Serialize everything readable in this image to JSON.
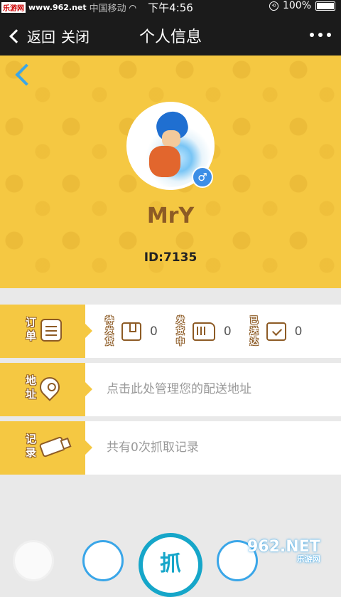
{
  "status_bar": {
    "watermark": "乐游网",
    "url": "www.962.net",
    "carrier": "中国移动",
    "time": "下午4:56",
    "battery": "100%"
  },
  "nav": {
    "back_label": "返回",
    "close_label": "关闭",
    "title": "个人信息"
  },
  "profile": {
    "username": "MrY",
    "id_text": "ID:7135",
    "gender_symbol": "♂"
  },
  "orders": {
    "tag_label": "订单",
    "items": [
      {
        "label": "待发货",
        "count": "0",
        "icon": "box-icon"
      },
      {
        "label": "发货中",
        "count": "0",
        "icon": "truck-icon"
      },
      {
        "label": "已送达",
        "count": "0",
        "icon": "delivered-icon"
      }
    ]
  },
  "address": {
    "tag_label": "地址",
    "text": "点击此处管理您的配送地址"
  },
  "records": {
    "tag_label": "记录",
    "text": "共有0次抓取记录"
  },
  "bottom": {
    "grab_label": "抓",
    "watermark": "962.NET",
    "watermark_sub": "乐游网"
  },
  "colors": {
    "accent_yellow": "#f5c842",
    "brown": "#8d5b25",
    "blue": "#3aa6e8"
  }
}
